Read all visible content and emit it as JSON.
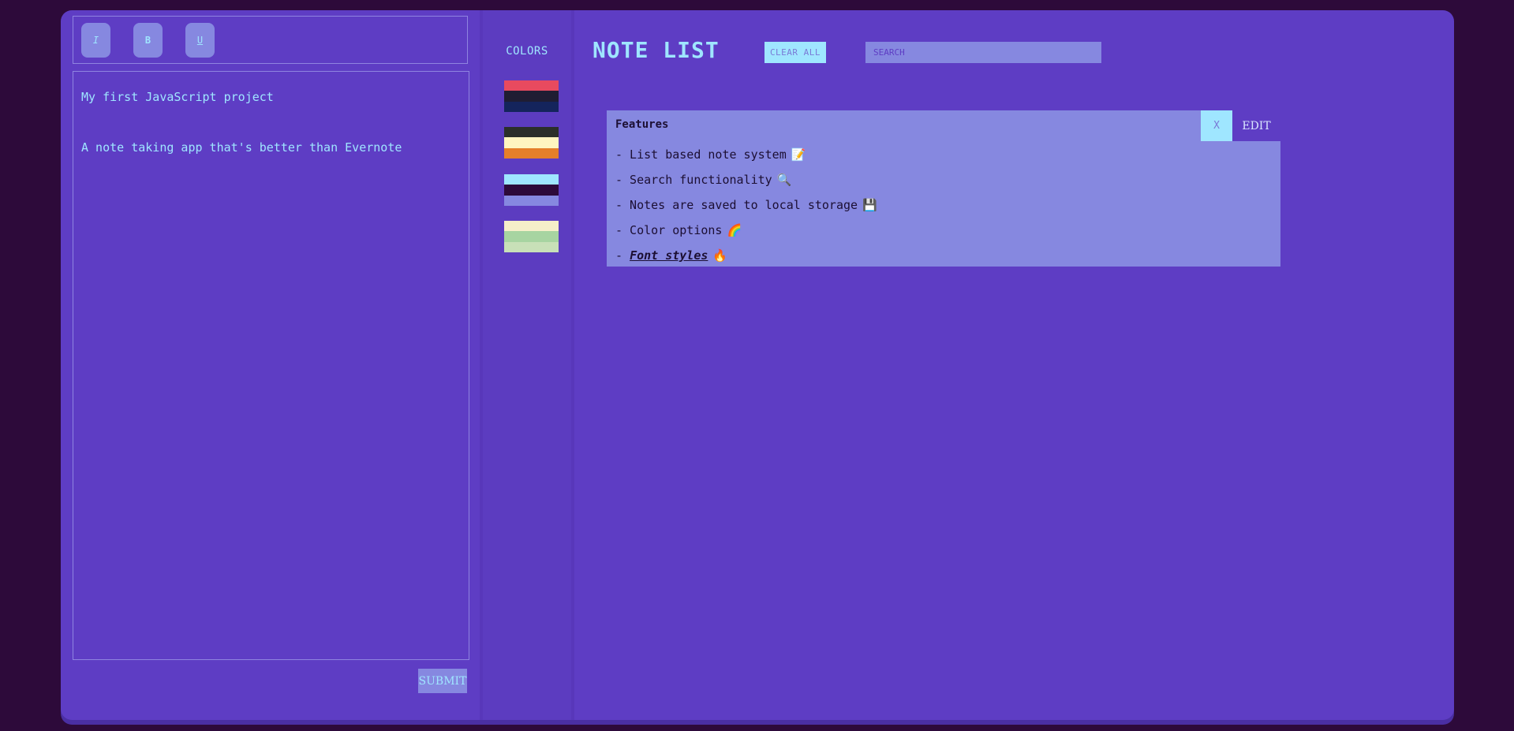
{
  "toolbar": {
    "italic_label": "I",
    "bold_label": "B",
    "underline_label": "U"
  },
  "editor": {
    "lines": [
      "My first JavaScript project",
      "",
      "A note taking app that's better than Evernote"
    ],
    "submit_label": "SUBMIT"
  },
  "colors": {
    "title": "COLORS",
    "swatches": [
      [
        "#e84a5f",
        "#1f1d33",
        "#14245c"
      ],
      [
        "#2b2f2a",
        "#fff5c0",
        "#e57f2a"
      ],
      [
        "#9fe6ff",
        "#2d0a3a",
        "#8688e0"
      ],
      [
        "#f6efc9",
        "#a7d4a1",
        "#c8e0b8"
      ]
    ]
  },
  "notes": {
    "title": "NOTE LIST",
    "clear_label": "CLEAR ALL",
    "search_placeholder": "SEARCH",
    "items": [
      {
        "title": "Features",
        "delete_label": "X",
        "edit_label": "EDIT",
        "lines": [
          {
            "text": "- List based note system",
            "emoji": "📝"
          },
          {
            "text": "- Search functionality",
            "emoji": "🔍"
          },
          {
            "text": "- Notes are saved to local storage",
            "emoji": "💾"
          },
          {
            "text": "- Color options",
            "emoji": "🌈"
          },
          {
            "prefix": "- ",
            "styled": "Font styles",
            "emoji": "🔥"
          }
        ]
      }
    ]
  },
  "theme": {
    "background": "#2d0a3a",
    "panel": "#5e3dc4",
    "accent": "#9fe6ff",
    "card": "#8688e0"
  }
}
